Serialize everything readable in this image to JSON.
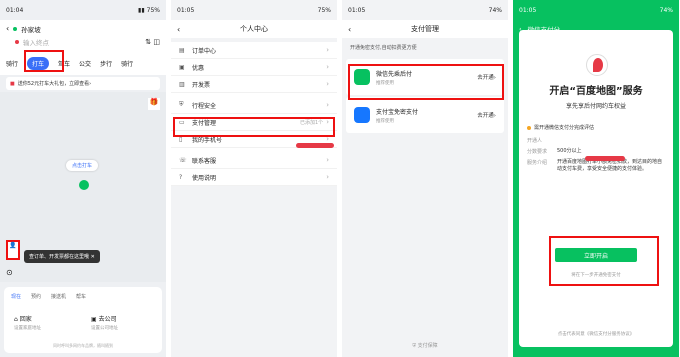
{
  "panel1": {
    "status": {
      "time": "01:04",
      "battery": "75%"
    },
    "origin": "孙家坡",
    "dest_placeholder": "输入终点",
    "tabs": [
      "骑行",
      "打车",
      "驾车",
      "公交",
      "步行",
      "骑行"
    ],
    "banner": "送你52元打车大礼包，立即查看›",
    "map_pill": "点击打车",
    "tooltip": "查订单、开发票都在这里哦",
    "side_label": "我的",
    "bottom_tabs": [
      "现在",
      "预约",
      "接送机",
      "帮车"
    ],
    "home": {
      "title": "回家",
      "sub": "设置家庭地址"
    },
    "work": {
      "title": "去公司",
      "sub": "设置公司地址"
    },
    "footer": "同时呼叫多网约车品牌，随叫随到"
  },
  "panel2": {
    "status": {
      "time": "01:05",
      "battery": "75%"
    },
    "title": "个人中心",
    "rows": [
      {
        "icon": "doc-icon",
        "glyph": "▤",
        "label": "订单中心",
        "right": ""
      },
      {
        "icon": "coupon-icon",
        "glyph": "▣",
        "label": "优惠",
        "right": ""
      },
      {
        "icon": "invoice-icon",
        "glyph": "▥",
        "label": "开发票",
        "right": ""
      },
      {
        "icon": "shield-icon",
        "glyph": "⛨",
        "label": "行程安全",
        "right": ""
      },
      {
        "icon": "wallet-icon",
        "glyph": "▭",
        "label": "支付管理",
        "right": "已添加1个"
      },
      {
        "icon": "phone-icon",
        "glyph": "▯",
        "label": "我的手机号",
        "right": ""
      },
      {
        "icon": "service-icon",
        "glyph": "☏",
        "label": "联系客服",
        "right": ""
      },
      {
        "icon": "help-icon",
        "glyph": "?",
        "label": "使用说明",
        "right": ""
      }
    ]
  },
  "panel3": {
    "status": {
      "time": "01:05",
      "battery": "74%"
    },
    "title": "支付管理",
    "note": "开通免密支付,自动扣费更方便",
    "methods": [
      {
        "name": "微信先乘后付",
        "sub": "推荐使用",
        "action": "去开通›",
        "color": "#07c160"
      },
      {
        "name": "支付宝免密支付",
        "sub": "推荐使用",
        "action": "去开通›",
        "color": "#1677ff"
      }
    ],
    "footer": "支付保障"
  },
  "panel4": {
    "status": {
      "time": "01:05",
      "battery": "74%"
    },
    "header": "微信支付分",
    "title": "开启“百度地图”服务",
    "subtitle": "享先享后付网约车权益",
    "requirement": "需开通微信支付分完成评估",
    "kv": [
      {
        "k": "开通人",
        "v": ""
      },
      {
        "k": "分数要求",
        "v": "500分以上"
      },
      {
        "k": "服务介绍",
        "v": "开通百度地图打车小额免密扣款，到达目的地自动支付车费，享受安全便捷的支付体验。"
      }
    ],
    "start": "立即开启",
    "later": "将在下一步开通免密支付",
    "agreement": "点击代表同意《微信支付分服务协议》"
  },
  "colors": {
    "accent_blue": "#3a6ff7",
    "wechat_green": "#07c160",
    "highlight_red": "#e11111"
  }
}
